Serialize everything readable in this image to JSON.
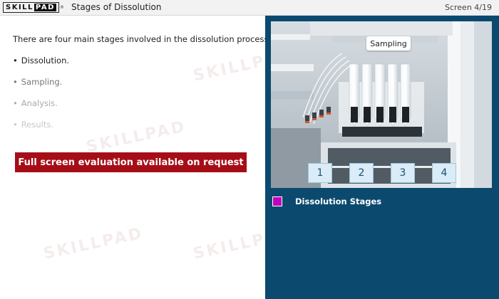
{
  "header": {
    "logo_text": "SKILLPAD",
    "title": "Stages of Dissolution",
    "screen_counter": "Screen 4/19"
  },
  "content": {
    "intro": "There are four main stages involved in the dissolution process:",
    "bullets": [
      "Dissolution.",
      "Sampling.",
      "Analysis.",
      "Results."
    ],
    "eval_banner": "Full screen evaluation available on request"
  },
  "panel": {
    "scene_label": "Sampling",
    "stage_buttons": [
      "1",
      "2",
      "3",
      "4"
    ],
    "caption": "Dissolution Stages"
  },
  "watermark_text": "SKILLPAD",
  "colors": {
    "marker": "#c000c0",
    "banner": "#a60e17",
    "panel_bg": "#0b4a6e",
    "stage_button_bg": "#d9ecf7"
  }
}
